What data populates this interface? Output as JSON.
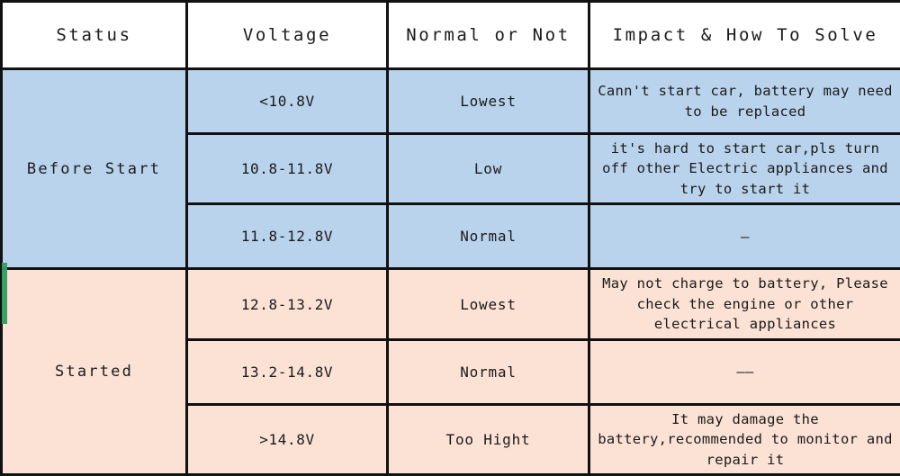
{
  "table": {
    "columns": [
      {
        "key": "status",
        "label": "Status"
      },
      {
        "key": "voltage",
        "label": "Voltage"
      },
      {
        "key": "normal",
        "label": "Normal or Not"
      },
      {
        "key": "impact",
        "label": "Impact & How To Solve"
      }
    ],
    "groups": [
      {
        "name": "Before Start",
        "background": "#b9d3ec",
        "rows": [
          {
            "voltage": "<10.8V",
            "normal": "Lowest",
            "severity": "warn",
            "impact": "Cann't start car, battery may need to be replaced"
          },
          {
            "voltage": "10.8-11.8V",
            "normal": "Low",
            "severity": "warn",
            "impact": "it's hard to start car,pls turn off other Electric appliances and try to start it"
          },
          {
            "voltage": "11.8-12.8V",
            "normal": "Normal",
            "severity": "ok",
            "impact": "—"
          }
        ]
      },
      {
        "name": "Started",
        "background": "#fce2d5",
        "rows": [
          {
            "voltage": "12.8-13.2V",
            "normal": "Lowest",
            "severity": "warn",
            "impact": "May not charge to battery, Please check the engine or other electrical appliances"
          },
          {
            "voltage": "13.2-14.8V",
            "normal": "Normal",
            "severity": "ok",
            "impact": "——"
          },
          {
            "voltage": ">14.8V",
            "normal": "Too Hight",
            "severity": "warn",
            "impact": "It may damage the battery,recommended to monitor and repair it"
          }
        ]
      }
    ]
  },
  "colors": {
    "before_start_background": "#b9d3ec",
    "started_background": "#fce2d5",
    "warning_text": "#e0893a",
    "normal_text": "#1a1a1a",
    "border": "#111111",
    "header_background": "#ffffff"
  }
}
